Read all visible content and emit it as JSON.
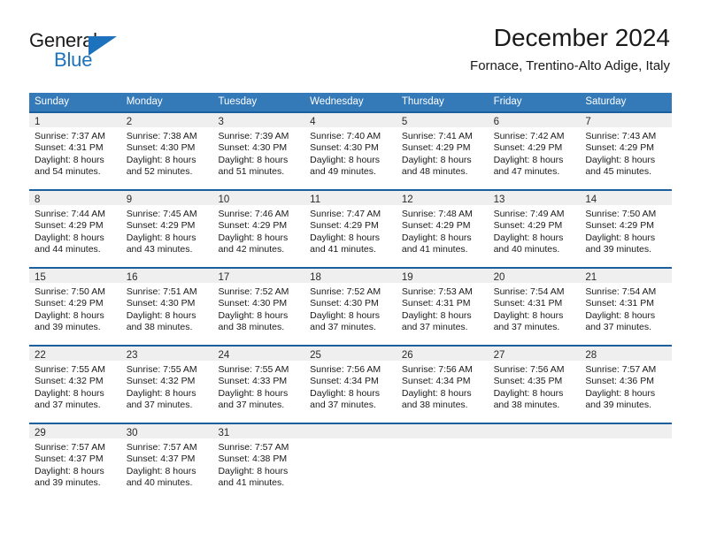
{
  "logo": {
    "word_top": "General",
    "word_bottom": "Blue",
    "triangle_icon": "triangle-flag-icon",
    "brand_color": "#1c72bc"
  },
  "header": {
    "title": "December 2024",
    "subtitle": "Fornace, Trentino-Alto Adige, Italy"
  },
  "theme": {
    "header_bg": "#3479b8",
    "row_border": "#1c5f9e",
    "daynum_bg": "#efefef"
  },
  "calendar": {
    "weekday_headers": [
      "Sunday",
      "Monday",
      "Tuesday",
      "Wednesday",
      "Thursday",
      "Friday",
      "Saturday"
    ],
    "weeks": [
      [
        {
          "day": "1",
          "sunrise": "Sunrise: 7:37 AM",
          "sunset": "Sunset: 4:31 PM",
          "daylight1": "Daylight: 8 hours",
          "daylight2": "and 54 minutes."
        },
        {
          "day": "2",
          "sunrise": "Sunrise: 7:38 AM",
          "sunset": "Sunset: 4:30 PM",
          "daylight1": "Daylight: 8 hours",
          "daylight2": "and 52 minutes."
        },
        {
          "day": "3",
          "sunrise": "Sunrise: 7:39 AM",
          "sunset": "Sunset: 4:30 PM",
          "daylight1": "Daylight: 8 hours",
          "daylight2": "and 51 minutes."
        },
        {
          "day": "4",
          "sunrise": "Sunrise: 7:40 AM",
          "sunset": "Sunset: 4:30 PM",
          "daylight1": "Daylight: 8 hours",
          "daylight2": "and 49 minutes."
        },
        {
          "day": "5",
          "sunrise": "Sunrise: 7:41 AM",
          "sunset": "Sunset: 4:29 PM",
          "daylight1": "Daylight: 8 hours",
          "daylight2": "and 48 minutes."
        },
        {
          "day": "6",
          "sunrise": "Sunrise: 7:42 AM",
          "sunset": "Sunset: 4:29 PM",
          "daylight1": "Daylight: 8 hours",
          "daylight2": "and 47 minutes."
        },
        {
          "day": "7",
          "sunrise": "Sunrise: 7:43 AM",
          "sunset": "Sunset: 4:29 PM",
          "daylight1": "Daylight: 8 hours",
          "daylight2": "and 45 minutes."
        }
      ],
      [
        {
          "day": "8",
          "sunrise": "Sunrise: 7:44 AM",
          "sunset": "Sunset: 4:29 PM",
          "daylight1": "Daylight: 8 hours",
          "daylight2": "and 44 minutes."
        },
        {
          "day": "9",
          "sunrise": "Sunrise: 7:45 AM",
          "sunset": "Sunset: 4:29 PM",
          "daylight1": "Daylight: 8 hours",
          "daylight2": "and 43 minutes."
        },
        {
          "day": "10",
          "sunrise": "Sunrise: 7:46 AM",
          "sunset": "Sunset: 4:29 PM",
          "daylight1": "Daylight: 8 hours",
          "daylight2": "and 42 minutes."
        },
        {
          "day": "11",
          "sunrise": "Sunrise: 7:47 AM",
          "sunset": "Sunset: 4:29 PM",
          "daylight1": "Daylight: 8 hours",
          "daylight2": "and 41 minutes."
        },
        {
          "day": "12",
          "sunrise": "Sunrise: 7:48 AM",
          "sunset": "Sunset: 4:29 PM",
          "daylight1": "Daylight: 8 hours",
          "daylight2": "and 41 minutes."
        },
        {
          "day": "13",
          "sunrise": "Sunrise: 7:49 AM",
          "sunset": "Sunset: 4:29 PM",
          "daylight1": "Daylight: 8 hours",
          "daylight2": "and 40 minutes."
        },
        {
          "day": "14",
          "sunrise": "Sunrise: 7:50 AM",
          "sunset": "Sunset: 4:29 PM",
          "daylight1": "Daylight: 8 hours",
          "daylight2": "and 39 minutes."
        }
      ],
      [
        {
          "day": "15",
          "sunrise": "Sunrise: 7:50 AM",
          "sunset": "Sunset: 4:29 PM",
          "daylight1": "Daylight: 8 hours",
          "daylight2": "and 39 minutes."
        },
        {
          "day": "16",
          "sunrise": "Sunrise: 7:51 AM",
          "sunset": "Sunset: 4:30 PM",
          "daylight1": "Daylight: 8 hours",
          "daylight2": "and 38 minutes."
        },
        {
          "day": "17",
          "sunrise": "Sunrise: 7:52 AM",
          "sunset": "Sunset: 4:30 PM",
          "daylight1": "Daylight: 8 hours",
          "daylight2": "and 38 minutes."
        },
        {
          "day": "18",
          "sunrise": "Sunrise: 7:52 AM",
          "sunset": "Sunset: 4:30 PM",
          "daylight1": "Daylight: 8 hours",
          "daylight2": "and 37 minutes."
        },
        {
          "day": "19",
          "sunrise": "Sunrise: 7:53 AM",
          "sunset": "Sunset: 4:31 PM",
          "daylight1": "Daylight: 8 hours",
          "daylight2": "and 37 minutes."
        },
        {
          "day": "20",
          "sunrise": "Sunrise: 7:54 AM",
          "sunset": "Sunset: 4:31 PM",
          "daylight1": "Daylight: 8 hours",
          "daylight2": "and 37 minutes."
        },
        {
          "day": "21",
          "sunrise": "Sunrise: 7:54 AM",
          "sunset": "Sunset: 4:31 PM",
          "daylight1": "Daylight: 8 hours",
          "daylight2": "and 37 minutes."
        }
      ],
      [
        {
          "day": "22",
          "sunrise": "Sunrise: 7:55 AM",
          "sunset": "Sunset: 4:32 PM",
          "daylight1": "Daylight: 8 hours",
          "daylight2": "and 37 minutes."
        },
        {
          "day": "23",
          "sunrise": "Sunrise: 7:55 AM",
          "sunset": "Sunset: 4:32 PM",
          "daylight1": "Daylight: 8 hours",
          "daylight2": "and 37 minutes."
        },
        {
          "day": "24",
          "sunrise": "Sunrise: 7:55 AM",
          "sunset": "Sunset: 4:33 PM",
          "daylight1": "Daylight: 8 hours",
          "daylight2": "and 37 minutes."
        },
        {
          "day": "25",
          "sunrise": "Sunrise: 7:56 AM",
          "sunset": "Sunset: 4:34 PM",
          "daylight1": "Daylight: 8 hours",
          "daylight2": "and 37 minutes."
        },
        {
          "day": "26",
          "sunrise": "Sunrise: 7:56 AM",
          "sunset": "Sunset: 4:34 PM",
          "daylight1": "Daylight: 8 hours",
          "daylight2": "and 38 minutes."
        },
        {
          "day": "27",
          "sunrise": "Sunrise: 7:56 AM",
          "sunset": "Sunset: 4:35 PM",
          "daylight1": "Daylight: 8 hours",
          "daylight2": "and 38 minutes."
        },
        {
          "day": "28",
          "sunrise": "Sunrise: 7:57 AM",
          "sunset": "Sunset: 4:36 PM",
          "daylight1": "Daylight: 8 hours",
          "daylight2": "and 39 minutes."
        }
      ],
      [
        {
          "day": "29",
          "sunrise": "Sunrise: 7:57 AM",
          "sunset": "Sunset: 4:37 PM",
          "daylight1": "Daylight: 8 hours",
          "daylight2": "and 39 minutes."
        },
        {
          "day": "30",
          "sunrise": "Sunrise: 7:57 AM",
          "sunset": "Sunset: 4:37 PM",
          "daylight1": "Daylight: 8 hours",
          "daylight2": "and 40 minutes."
        },
        {
          "day": "31",
          "sunrise": "Sunrise: 7:57 AM",
          "sunset": "Sunset: 4:38 PM",
          "daylight1": "Daylight: 8 hours",
          "daylight2": "and 41 minutes."
        },
        {
          "day": "",
          "sunrise": "",
          "sunset": "",
          "daylight1": "",
          "daylight2": ""
        },
        {
          "day": "",
          "sunrise": "",
          "sunset": "",
          "daylight1": "",
          "daylight2": ""
        },
        {
          "day": "",
          "sunrise": "",
          "sunset": "",
          "daylight1": "",
          "daylight2": ""
        },
        {
          "day": "",
          "sunrise": "",
          "sunset": "",
          "daylight1": "",
          "daylight2": ""
        }
      ]
    ]
  }
}
